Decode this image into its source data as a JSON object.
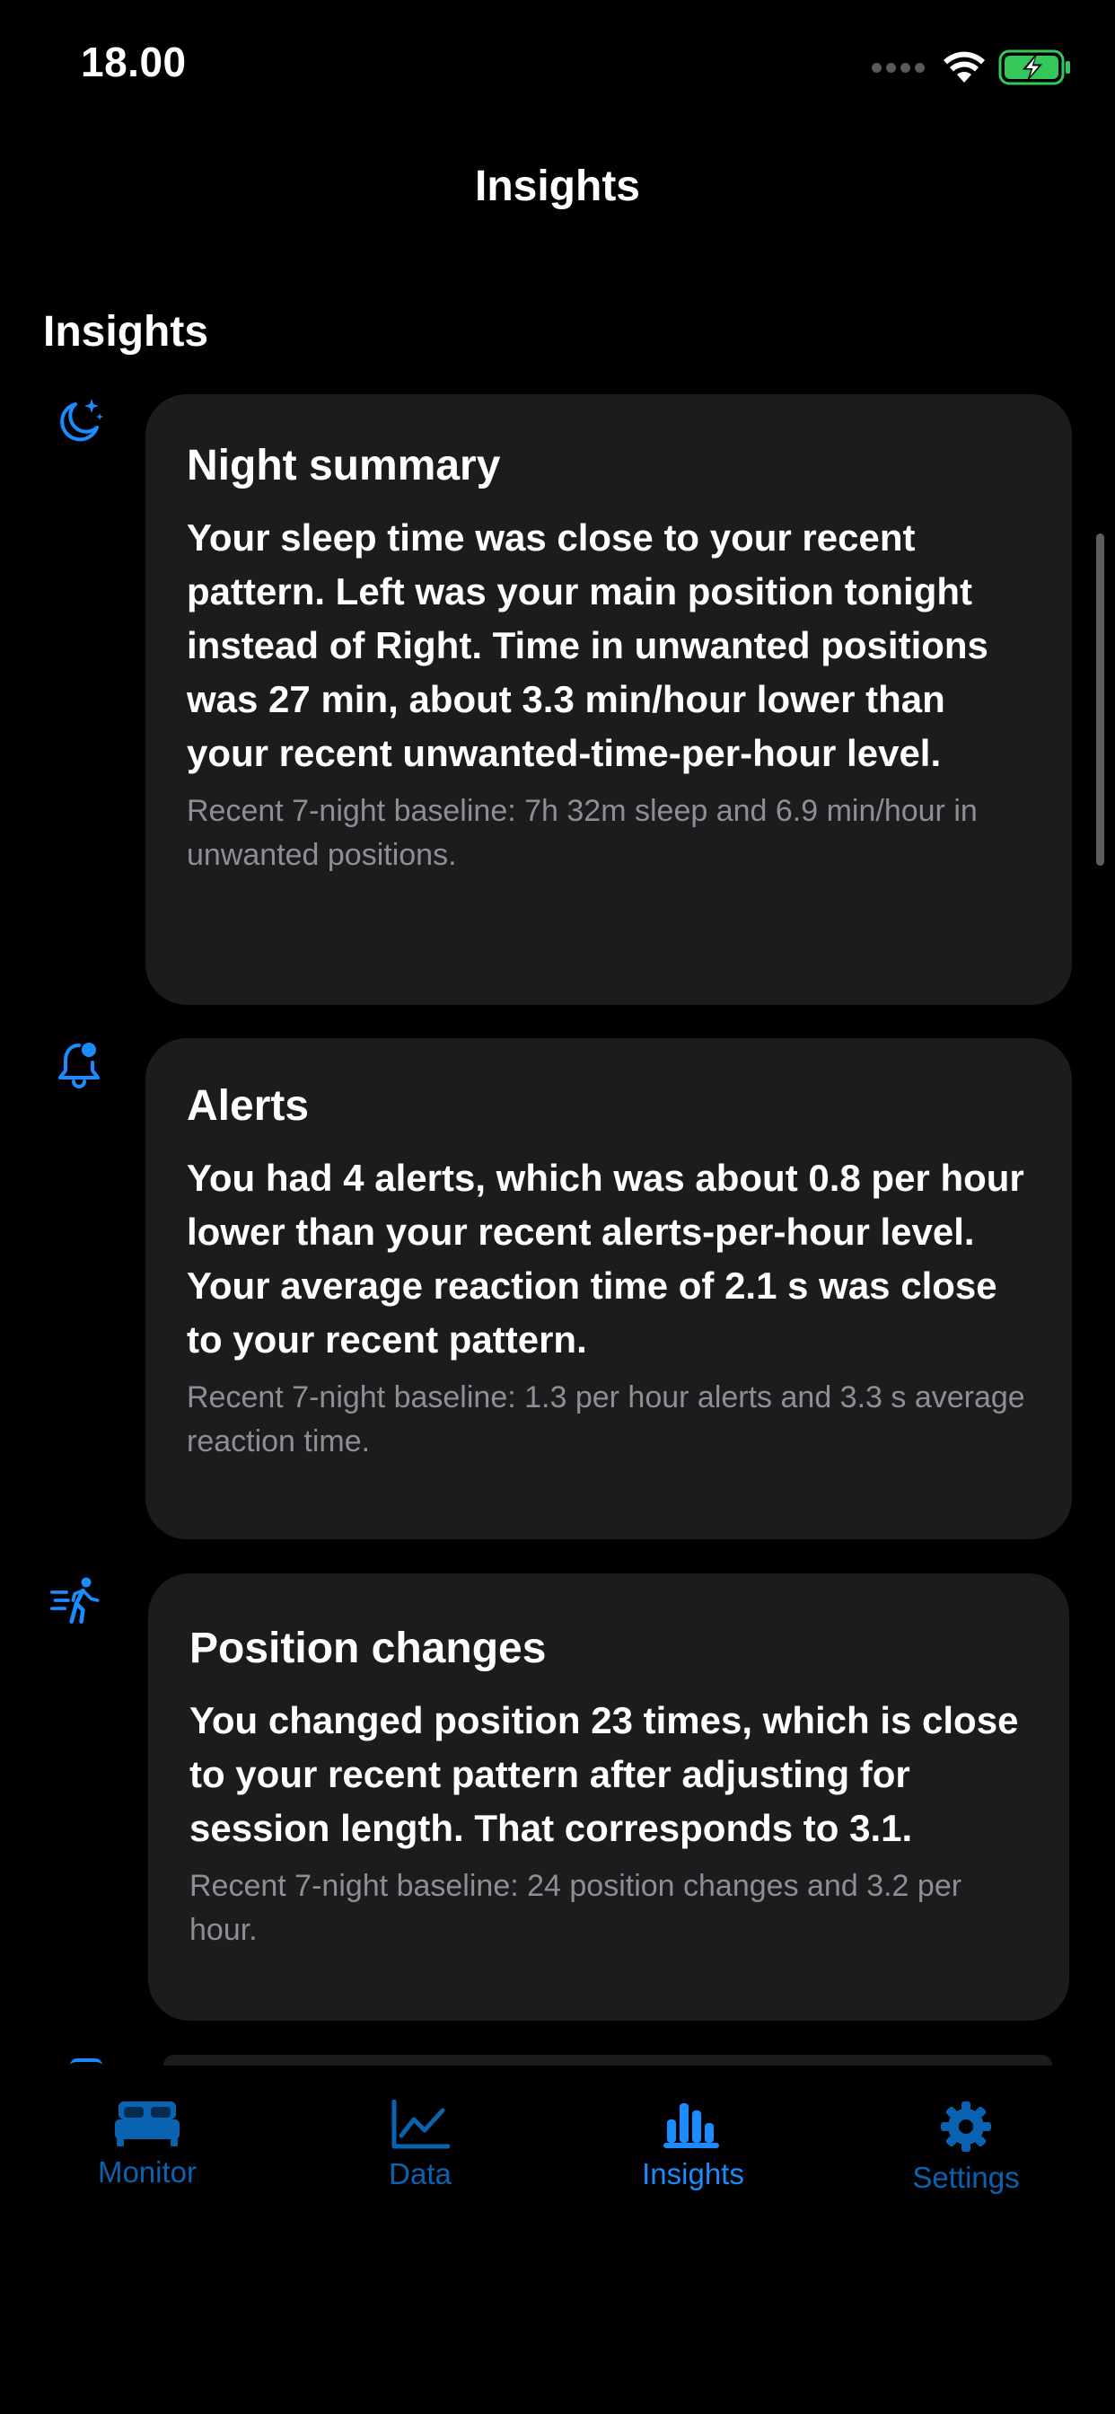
{
  "status_bar": {
    "time": "18.00"
  },
  "nav": {
    "title": "Insights"
  },
  "section": {
    "title": "Insights"
  },
  "cards": [
    {
      "icon": "moon-stars-icon",
      "title": "Night summary",
      "body": "Your sleep time was close to your recent pattern. Left was your main position tonight instead of Right. Time in unwanted positions was 27 min, about 3.3 min/hour lower than your recent unwanted-time-per-hour level.",
      "note": "Recent 7-night baseline: 7h 32m sleep and 6.9 min/hour in unwanted positions."
    },
    {
      "icon": "bell-badge-icon",
      "title": "Alerts",
      "body": "You had 4 alerts, which was about 0.8 per hour lower than your recent alerts-per-hour level. Your average reaction time of 2.1 s was close to your recent pattern.",
      "note": "Recent 7-night baseline: 1.3 per hour alerts and 3.3 s average reaction time."
    },
    {
      "icon": "figure-walk-motion-icon",
      "title": "Position changes",
      "body": "You changed position 23 times, which is close to your recent pattern after adjusting for session length. That corresponds to 3.1.",
      "note": "Recent 7-night baseline: 24 position changes and 3.2 per hour."
    }
  ],
  "tabs": [
    {
      "label": "Monitor",
      "icon": "bed-icon",
      "active": false
    },
    {
      "label": "Data",
      "icon": "line-chart-icon",
      "active": false
    },
    {
      "label": "Insights",
      "icon": "bar-chart-icon",
      "active": true
    },
    {
      "label": "Settings",
      "icon": "gear-icon",
      "active": false
    }
  ],
  "colors": {
    "accent": "#1a8cff",
    "card_bg": "#1c1c1e",
    "secondary_text": "#8e8e93",
    "battery": "#34c759"
  }
}
